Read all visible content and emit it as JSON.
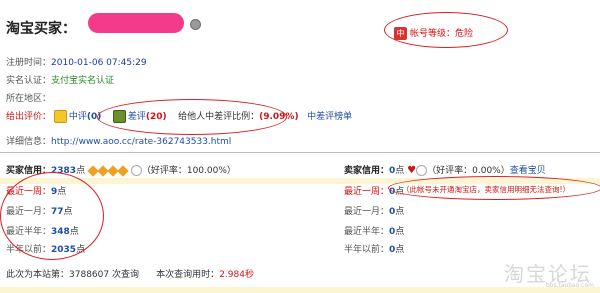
{
  "header": {
    "title": "淘宝买家：",
    "account_level": "帐号等级：危险",
    "shield_glyph": "中"
  },
  "info": {
    "register_label": "注册时间：",
    "register_value": "2010-01-06 07:45:29",
    "realname_label": "实名认证：",
    "realname_value": "支付宝实名认证",
    "location_label": "所在地区："
  },
  "ratings": {
    "given_label": "给出评价：",
    "mid_label": "中评",
    "mid_count": "(0)",
    "bad_label": "差评",
    "bad_count": "(20)",
    "ratio_label": "给他人中差评比例：",
    "ratio_value": "(9.09%)",
    "list_link": "中差评榜单"
  },
  "detail": {
    "label": "详细信息：",
    "url": "http://www.aoo.cc/rate-362743533.html"
  },
  "buyer": {
    "label": "买家信用：",
    "score": "2383",
    "score_unit": "点",
    "good_rate": "（好评率：100.00%）",
    "rows": [
      {
        "label": "最近一周：",
        "value": "9",
        "unit": "点"
      },
      {
        "label": "最近一月：",
        "value": "77",
        "unit": "点"
      },
      {
        "label": "最近半年：",
        "value": "348",
        "unit": "点"
      },
      {
        "label": "半年以前：",
        "value": "2035",
        "unit": "点"
      }
    ]
  },
  "seller": {
    "label": "卖家信用：",
    "score": "0",
    "score_unit": "点",
    "good_rate": "（好评率：0.00%）",
    "view_link": "查看宝贝",
    "note": "（此帐号未开通淘宝店，卖家信用明细无法查询!）",
    "rows": [
      {
        "label": "最近一周：",
        "value": "0",
        "unit": "点"
      },
      {
        "label": "最近一月：",
        "value": "0",
        "unit": "点"
      },
      {
        "label": "最近半年：",
        "value": "0",
        "unit": "点"
      },
      {
        "label": "半年以前：",
        "value": "0",
        "unit": "点"
      }
    ]
  },
  "footer": {
    "rank_label": "此次为本站第：",
    "rank_value": "3788607",
    "rank_suffix": "次查询",
    "time_label": "本次查询用时：",
    "time_value": "2.984秒"
  },
  "watermark": {
    "text": "淘宝论坛",
    "url": "bbs.taobao.com"
  }
}
